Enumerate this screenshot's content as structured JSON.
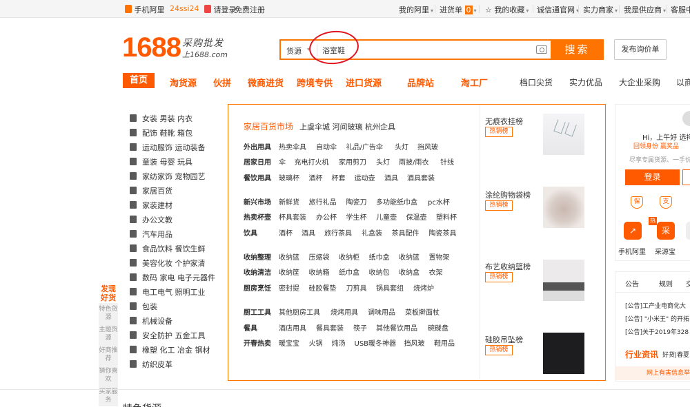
{
  "topbar": {
    "mobile": "手机阿里",
    "tag": "24ssi24",
    "login": "请登录",
    "register": "免费注册",
    "my_ali": "我的阿里",
    "cart": "进货单",
    "cart_count": "0",
    "favorites": "我的收藏",
    "chengxintong": "诚信通官网",
    "merchants": "实力商家",
    "supplier": "我是供应商",
    "service": "客服中心"
  },
  "logo": {
    "number": "1688",
    "slogan": "采购批发",
    "url": "上1688.com"
  },
  "search": {
    "category": "货源",
    "value": "浴室鞋",
    "button": "搜索",
    "rfq": "发布询价单"
  },
  "nav": {
    "items": [
      "首页",
      "淘货源",
      "伙拼",
      "微商进货",
      "跨境专供",
      "进口货源",
      "品牌站",
      "淘工厂"
    ],
    "gray_items": [
      "档口尖货",
      "实力优品",
      "大企业采购",
      "以商会友"
    ]
  },
  "categories": [
    "女装 男装 内衣",
    "配饰 鞋靴 箱包",
    "运动服饰 运动装备",
    "童装 母婴 玩具",
    "家纺家饰 宠物园艺",
    "家居百货",
    "家装建材",
    "办公文教",
    "汽车用品",
    "食品饮料 餐饮生鲜",
    "美容化妆 个护家清",
    "数码 家电 电子元器件",
    "电工电气 照明工业",
    "包装",
    "机械设备",
    "安全防护 五金工具",
    "橡塑 化工 冶金 钢材",
    "纺织皮革"
  ],
  "side": {
    "discover": "发现好货",
    "tabs": [
      "特色货源",
      "主题货源",
      "好商推荐",
      "猜你喜欢",
      "买家服务"
    ]
  },
  "panel": {
    "title": "家居百货市场",
    "subtitle": "上虞伞城 河间玻璃 杭州企具",
    "rows": [
      {
        "label": "外出用具",
        "items": [
          "热卖伞具",
          "自动伞",
          "礼品/广告伞",
          "头灯",
          "挡风玻"
        ]
      },
      {
        "label": "居家日用",
        "items": [
          "伞",
          "充电打火机",
          "家用剪刀",
          "头灯",
          "雨披/雨衣",
          "针线"
        ]
      },
      {
        "label": "餐饮用具",
        "items": [
          "玻璃杯",
          "酒杯",
          "杯套",
          "运动壶",
          "酒具",
          "酒具套装"
        ]
      },
      {
        "label": "新兴市场",
        "items": [
          "新鲜货",
          "旅行礼品",
          "陶瓷刀",
          "多功能纸巾盒",
          "pc水杯"
        ]
      },
      {
        "label": "热卖杯壶",
        "items": [
          "杯具套装",
          "办公杯",
          "学生杯",
          "儿童壶",
          "保温壶",
          "塑料杯"
        ]
      },
      {
        "label": "饮具",
        "items": [
          "酒杯",
          "酒具",
          "旅行茶具",
          "礼盒装",
          "茶具配件",
          "陶瓷茶具"
        ]
      },
      {
        "label": "收纳整理",
        "items": [
          "收纳篮",
          "压缩袋",
          "收纳柜",
          "纸巾盒",
          "收纳篮",
          "置物架"
        ]
      },
      {
        "label": "收纳清洁",
        "items": [
          "收纳筐",
          "收纳箱",
          "纸巾盒",
          "收纳包",
          "收纳盒",
          "衣架"
        ]
      },
      {
        "label": "厨房烹饪",
        "items": [
          "密封提",
          "硅胶餐垫",
          "刀剪具",
          "锅具套组",
          "烧烤炉"
        ]
      },
      {
        "label": "厨工工具",
        "items": [
          "其他厨房工具",
          "烧烤用具",
          "调味用品",
          "菜板擀面杖"
        ]
      },
      {
        "label": "餐具",
        "items": [
          "酒店用具",
          "餐具套装",
          "筷子",
          "其他餐饮用品",
          "碗碟盘"
        ]
      },
      {
        "label": "开春热卖",
        "items": [
          "暖宝宝",
          "火锅",
          "炖汤",
          "USB暖冬神器",
          "挡风玻",
          "鞋用品"
        ]
      }
    ],
    "rankings": [
      {
        "title": "无痕衣挂榜",
        "tag": "热销榜"
      },
      {
        "title": "涂纶购物袋榜",
        "tag": "热销榜"
      },
      {
        "title": "布艺收纳篮榜",
        "tag": "热销榜"
      },
      {
        "title": "硅胶吊坠榜",
        "tag": "热销榜"
      }
    ]
  },
  "user": {
    "greeting": "Hi，上午好",
    "select": "选择",
    "links": "回领身份 赢奖品",
    "prompt": "尽享专属货源、一手价",
    "login": "登录",
    "shields": [
      "保",
      "支"
    ],
    "apps": [
      {
        "label": "手机阿里",
        "hot": "热"
      },
      {
        "label": "采源宝",
        "glyph": "采"
      },
      {
        "label": "...",
        "glyph": ""
      }
    ]
  },
  "news": {
    "tabs": [
      "公告",
      "规则",
      "交"
    ],
    "items": [
      "[公告]工产业电商化大",
      "[公告] \"小米王\" 的开拓",
      "[公告]关于2019年328"
    ],
    "trade": "行业资讯",
    "trade_sub": "好货|春夏",
    "notice": "网上有害信息举"
  },
  "bottom": {
    "title": "特色货源"
  },
  "colors": {
    "accent": "#ff7300",
    "brand": "#ff5a00",
    "annotation": "#e0141e"
  }
}
